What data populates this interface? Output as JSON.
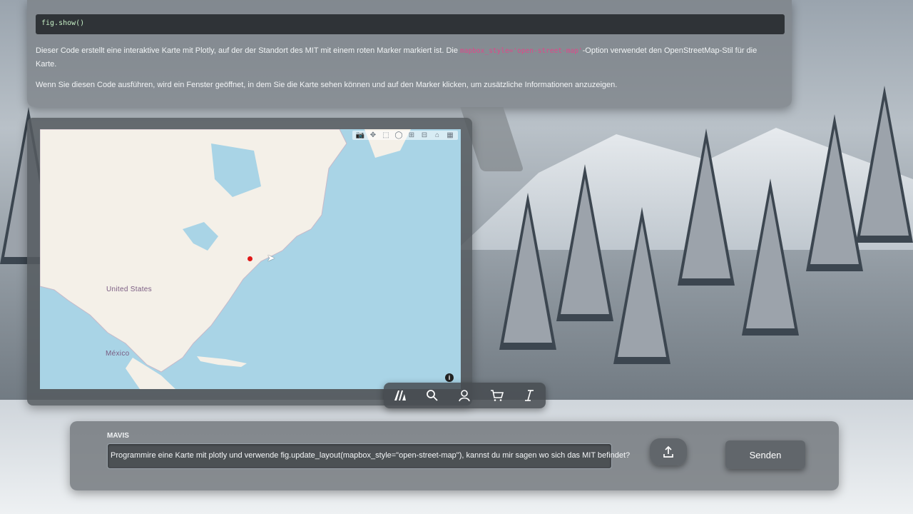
{
  "chat": {
    "code_line": "fig.show()",
    "paragraph1_before": "Dieser Code erstellt eine interaktive Karte mit Plotly, auf der der Standort des MIT mit einem roten Marker markiert ist. Die ",
    "paragraph1_code": "mapbox_style='open-street-map'",
    "paragraph1_after": "-Option verwendet den OpenStreetMap-Stil für die Karte.",
    "paragraph2": "Wenn Sie diesen Code ausführen, wird ein Fenster geöffnet, in dem Sie die Karte sehen können und auf den Marker klicken, um zusätzliche Informationen anzuzeigen."
  },
  "map": {
    "labels": {
      "usa": "United States",
      "mexico": "México"
    },
    "marker_color": "#e01818",
    "modebar_icons": [
      "camera-icon",
      "pan-icon",
      "box-select-icon",
      "lasso-icon",
      "zoom-in-icon",
      "zoom-out-icon",
      "home-icon",
      "plotly-logo-icon"
    ],
    "info_symbol": "i"
  },
  "toolbar": {
    "icons": [
      "logo-icon",
      "search-icon",
      "user-icon",
      "cart-icon",
      "italic-icon"
    ]
  },
  "input": {
    "label": "MAVIS",
    "prompt": "Programmire eine Karte mit plotly und verwende fig.update_layout(mapbox_style=\"open-street-map\"), kannst du mir sagen wo sich das MIT befindet?",
    "send_label": "Senden",
    "upload_icon": "upload-icon"
  }
}
